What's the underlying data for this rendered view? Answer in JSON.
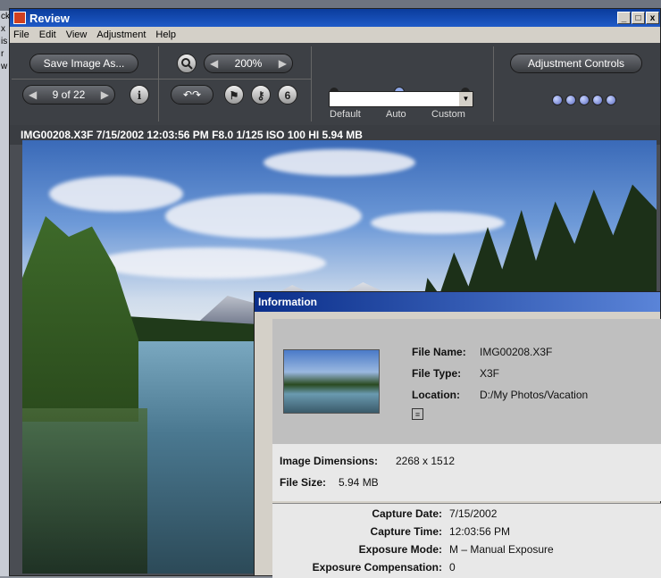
{
  "bg": {
    "left_letters": [
      "ck",
      "x",
      "is",
      "r",
      "w"
    ]
  },
  "window": {
    "title": "Review",
    "controls": [
      "_",
      "□",
      "x"
    ]
  },
  "menu": [
    "File",
    "Edit",
    "View",
    "Adjustment",
    "Help"
  ],
  "toolbar": {
    "save_label": "Save Image As...",
    "zoom_value": "200%",
    "nav_value": "9 of 22",
    "info_glyph": "i",
    "slider_labels": [
      "Default",
      "Auto",
      "Custom"
    ],
    "slider_position": "Auto",
    "combo_value": "",
    "adjustment_label": "Adjustment Controls",
    "dots_count": 5
  },
  "info_line": "IMG00208.X3F  7/15/2002  12:03:56 PM  F8.0  1/125  ISO 100  HI  5.94 MB",
  "info_panel": {
    "title": "Information",
    "file_name_label": "File Name:",
    "file_name": "IMG00208.X3F",
    "file_type_label": "File Type:",
    "file_type": "X3F",
    "location_label": "Location:",
    "location": "D:/My Photos/Vacation",
    "dimensions_label": "Image Dimensions:",
    "dimensions": "2268 x 1512",
    "file_size_label": "File Size:",
    "file_size": "5.94 MB",
    "capture": [
      {
        "label": "Capture Date:",
        "value": "7/15/2002"
      },
      {
        "label": "Capture Time:",
        "value": "12:03:56 PM"
      },
      {
        "label": "Exposure Mode:",
        "value": "M – Manual Exposure"
      },
      {
        "label": "Exposure Compensation:",
        "value": "0"
      }
    ]
  },
  "colors": {
    "title_bar": "#0a3c9c",
    "panel_bg": "#3d4045",
    "accent_knob": "#8fa8e8"
  },
  "icons": [
    "app-icon",
    "zoom-icon",
    "rotate-left-icon",
    "rotate-right-icon",
    "flag-icon",
    "key-icon",
    "lock-icon",
    "info-icon",
    "file-icon"
  ]
}
